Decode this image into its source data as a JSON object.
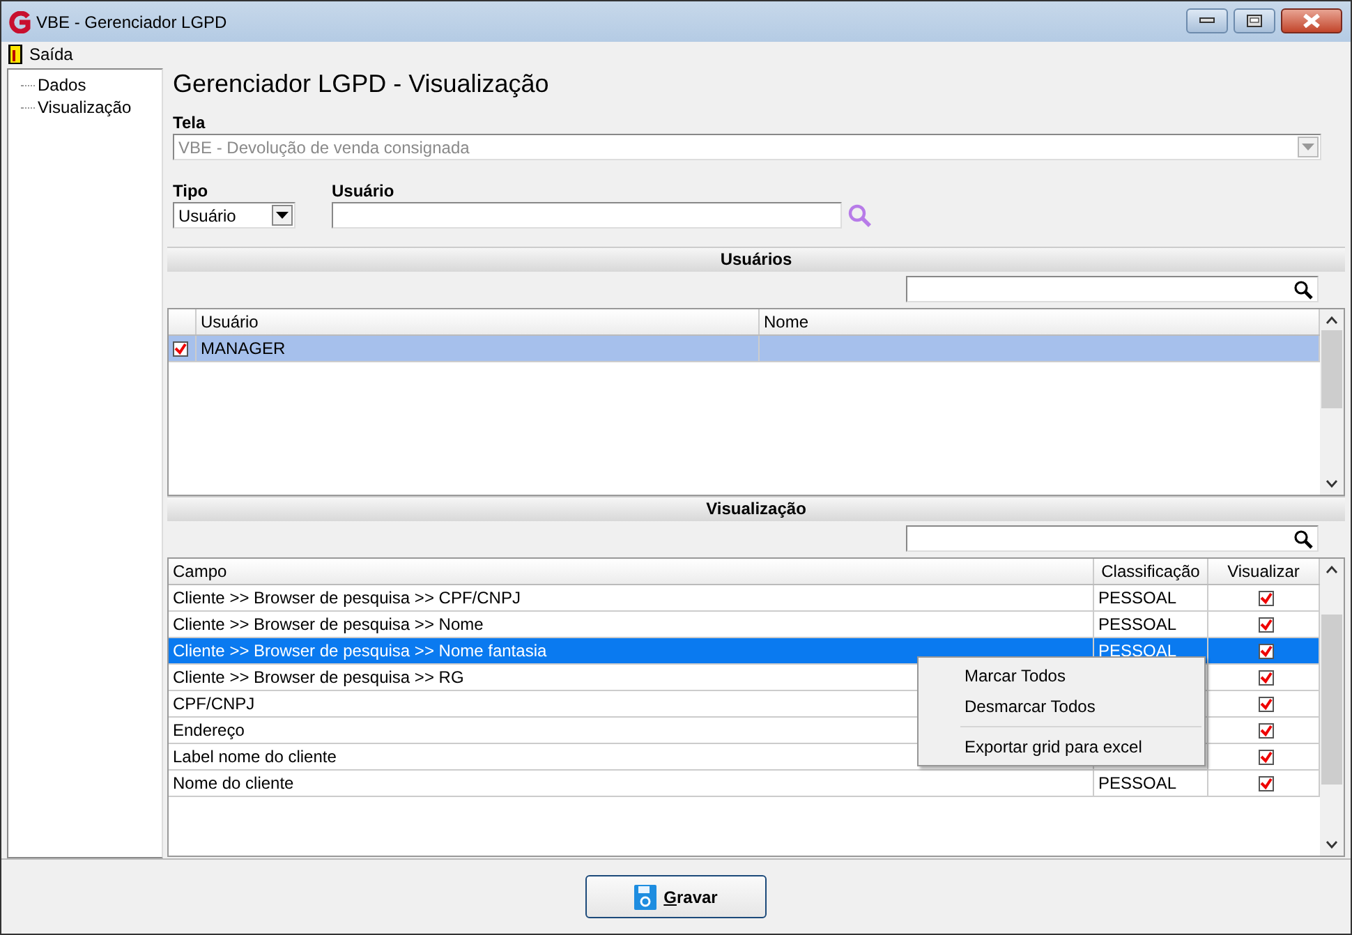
{
  "window": {
    "title": "VBE - Gerenciador LGPD"
  },
  "menu": [
    {
      "label": "Saída"
    }
  ],
  "tree": [
    {
      "label": "Dados"
    },
    {
      "label": "Visualização"
    }
  ],
  "heading": "Gerenciador LGPD - Visualização",
  "tela": {
    "label": "Tela",
    "value": "VBE - Devolução de venda consignada",
    "disabled": true
  },
  "tipo": {
    "label": "Tipo",
    "value": "Usuário"
  },
  "usuario": {
    "label": "Usuário"
  },
  "users_section": {
    "title": "Usuários",
    "columns": [
      "Usuário",
      "Nome"
    ],
    "rows": [
      {
        "checked": true,
        "selected": true,
        "usuario": "MANAGER"
      }
    ]
  },
  "view_section": {
    "title": "Visualização",
    "columns": [
      "Campo",
      "Classificação",
      "Visualizar"
    ],
    "rows": [
      {
        "campo": "Cliente >> Browser de pesquisa >> CPF/CNPJ",
        "classificacao": "PESSOAL",
        "visualizar": true,
        "selected": false
      },
      {
        "campo": "Cliente >> Browser de pesquisa >> Nome",
        "classificacao": "PESSOAL",
        "visualizar": true,
        "selected": false
      },
      {
        "campo": "Cliente >> Browser de pesquisa >> Nome fantasia",
        "classificacao": "PESSOAL",
        "visualizar": true,
        "selected": true
      },
      {
        "campo": "Cliente >> Browser de pesquisa >> RG",
        "visualizar": true,
        "selected": false
      },
      {
        "campo": "CPF/CNPJ",
        "visualizar": true,
        "selected": false
      },
      {
        "campo": "Endereço",
        "visualizar": true,
        "selected": false
      },
      {
        "campo": "Label nome do cliente",
        "visualizar": true,
        "selected": false
      },
      {
        "campo": "Nome do cliente",
        "classificacao": "PESSOAL",
        "visualizar": true,
        "selected": false
      }
    ]
  },
  "context_menu": {
    "groups": [
      [
        "Marcar Todos",
        "Desmarcar Todos"
      ],
      [
        "Exportar grid para excel"
      ]
    ]
  },
  "save_button": {
    "label": "Gravar"
  }
}
